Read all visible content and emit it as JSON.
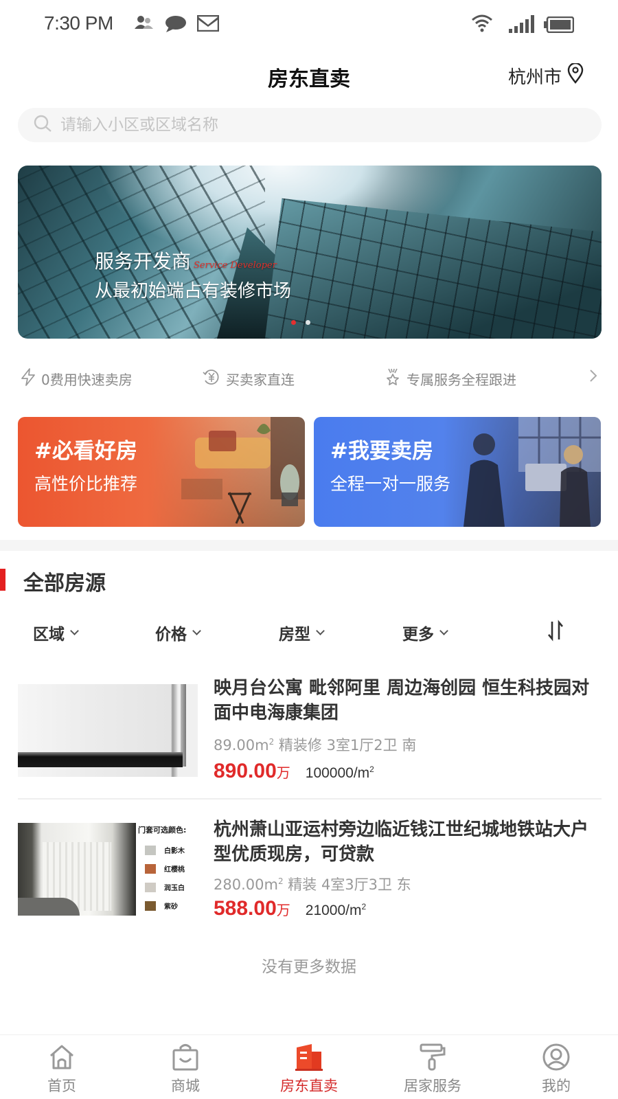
{
  "status_bar": {
    "time": "7:30 PM",
    "left_icons": [
      "contacts-icon",
      "chat-bubble-icon",
      "mail-icon"
    ],
    "right_icons": [
      "wifi-icon",
      "signal-icon",
      "battery-icon"
    ]
  },
  "header": {
    "title": "房东直卖",
    "city": "杭州市",
    "city_icon": "location-pin-icon"
  },
  "search": {
    "placeholder": "请输入小区或区域名称",
    "value": ""
  },
  "banner": {
    "headline": "服务开发商",
    "headline_en": "Service Developer",
    "subline": "从最初始端占有装修市场",
    "slide_count": 2,
    "active_slide": 1
  },
  "features": {
    "items": [
      {
        "icon": "lightning-icon",
        "label": "0费用快速卖房"
      },
      {
        "icon": "yen-cycle-icon",
        "label": "买卖家直连"
      },
      {
        "icon": "award-ribbon-icon",
        "label": "专属服务全程跟进"
      }
    ],
    "more_icon": "chevron-right-icon"
  },
  "promos": [
    {
      "title": "#必看好房",
      "subtitle": "高性价比推荐",
      "color": "#ec5630"
    },
    {
      "title": "#我要卖房",
      "subtitle": "全程一对一服务",
      "color": "#4a7cee"
    }
  ],
  "section": {
    "title": "全部房源",
    "accent": "#e32020"
  },
  "filters": {
    "items": [
      "区域",
      "价格",
      "房型",
      "更多"
    ],
    "sort_icon": "sort-arrows-icon"
  },
  "listings": [
    {
      "title": "映月台公寓 毗邻阿里 周边海创园 恒生科技园对面中电海康集团",
      "area": "89.00m",
      "details": "精装修 3室1厅2卫 南",
      "price": "890.00",
      "price_unit": "万",
      "unit_price": "100000/m"
    },
    {
      "title": "杭州萧山亚运村旁边临近钱江世纪城地铁站大户型优质现房，可贷款",
      "area": "280.00m",
      "details": "精装 4室3厅3卫 东",
      "price": "588.00",
      "price_unit": "万",
      "unit_price": "21000/m",
      "image_caption": "门套可选颜色:",
      "swatches": [
        {
          "name": "白影木",
          "color": "#c5c6c1"
        },
        {
          "name": "红樱桃",
          "color": "#b8643a"
        },
        {
          "name": "润玉白",
          "color": "#cfcbc4"
        },
        {
          "name": "紫砂",
          "color": "#7a5a30"
        }
      ]
    }
  ],
  "sup2": "2",
  "no_more": "没有更多数据",
  "bottom_nav": {
    "items": [
      {
        "label": "首页",
        "icon": "home-icon",
        "active": false
      },
      {
        "label": "商城",
        "icon": "shopping-bag-icon",
        "active": false
      },
      {
        "label": "房东直卖",
        "icon": "building-icon",
        "active": true
      },
      {
        "label": "居家服务",
        "icon": "paint-roller-icon",
        "active": false
      },
      {
        "label": "我的",
        "icon": "user-profile-icon",
        "active": false
      }
    ],
    "active_color": "#d42a2a"
  }
}
